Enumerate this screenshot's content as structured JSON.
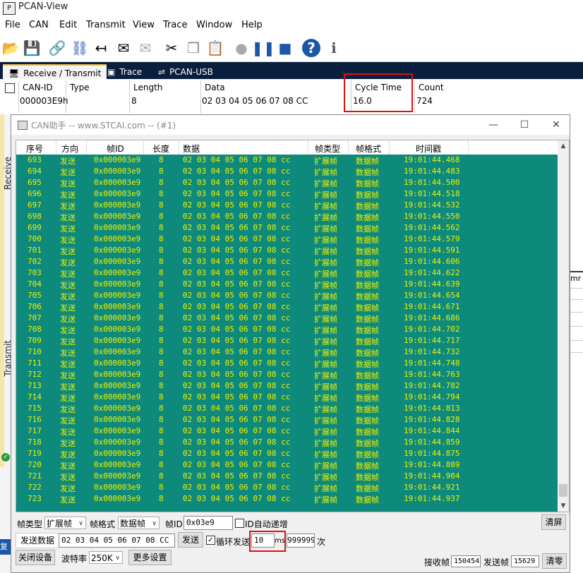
{
  "pcan": {
    "title": "PCAN-View",
    "menu": [
      "File",
      "CAN",
      "Edit",
      "Transmit",
      "View",
      "Trace",
      "Window",
      "Help"
    ],
    "tabs": [
      "Receive / Transmit",
      "Trace",
      "PCAN-USB"
    ],
    "receive_headers": [
      "CAN-ID",
      "Type",
      "Length",
      "Data",
      "Cycle Time",
      "Count"
    ],
    "receive_row": {
      "can_id": "000003E9h",
      "type": "",
      "length": "8",
      "data": "02 03 04 05 06 07 08 CC",
      "cycle_time": "16.0",
      "count": "724"
    },
    "side_labels": {
      "receive": "Receive",
      "transmit": "Transmit"
    },
    "right_partial": "mr",
    "left_partial": "复"
  },
  "canwin": {
    "title": "CAN助手 -- www.STCAI.com -- (#1)",
    "columns": [
      "序号",
      "方向",
      "帧ID",
      "长度",
      "数据",
      "帧类型",
      "帧格式",
      "时间戳"
    ],
    "rows": [
      {
        "seq": "693",
        "dir": "发送",
        "id": "0x000003e9",
        "len": "8",
        "data": "02 03 04 05 06 07 08 cc",
        "ftype": "扩展帧",
        "fmt": "数据帧",
        "ts": "19:01:44.468"
      },
      {
        "seq": "694",
        "dir": "发送",
        "id": "0x000003e9",
        "len": "8",
        "data": "02 03 04 05 06 07 08 cc",
        "ftype": "扩展帧",
        "fmt": "数据帧",
        "ts": "19:01:44.483"
      },
      {
        "seq": "695",
        "dir": "发送",
        "id": "0x000003e9",
        "len": "8",
        "data": "02 03 04 05 06 07 08 cc",
        "ftype": "扩展帧",
        "fmt": "数据帧",
        "ts": "19:01:44.500"
      },
      {
        "seq": "696",
        "dir": "发送",
        "id": "0x000003e9",
        "len": "8",
        "data": "02 03 04 05 06 07 08 cc",
        "ftype": "扩展帧",
        "fmt": "数据帧",
        "ts": "19:01:44.518"
      },
      {
        "seq": "697",
        "dir": "发送",
        "id": "0x000003e9",
        "len": "8",
        "data": "02 03 04 05 06 07 08 cc",
        "ftype": "扩展帧",
        "fmt": "数据帧",
        "ts": "19:01:44.532"
      },
      {
        "seq": "698",
        "dir": "发送",
        "id": "0x000003e9",
        "len": "8",
        "data": "02 03 04 05 06 07 08 cc",
        "ftype": "扩展帧",
        "fmt": "数据帧",
        "ts": "19:01:44.550"
      },
      {
        "seq": "699",
        "dir": "发送",
        "id": "0x000003e9",
        "len": "8",
        "data": "02 03 04 05 06 07 08 cc",
        "ftype": "扩展帧",
        "fmt": "数据帧",
        "ts": "19:01:44.562"
      },
      {
        "seq": "700",
        "dir": "发送",
        "id": "0x000003e9",
        "len": "8",
        "data": "02 03 04 05 06 07 08 cc",
        "ftype": "扩展帧",
        "fmt": "数据帧",
        "ts": "19:01:44.579"
      },
      {
        "seq": "701",
        "dir": "发送",
        "id": "0x000003e9",
        "len": "8",
        "data": "02 03 04 05 06 07 08 cc",
        "ftype": "扩展帧",
        "fmt": "数据帧",
        "ts": "19:01:44.591"
      },
      {
        "seq": "702",
        "dir": "发送",
        "id": "0x000003e9",
        "len": "8",
        "data": "02 03 04 05 06 07 08 cc",
        "ftype": "扩展帧",
        "fmt": "数据帧",
        "ts": "19:01:44.606"
      },
      {
        "seq": "703",
        "dir": "发送",
        "id": "0x000003e9",
        "len": "8",
        "data": "02 03 04 05 06 07 08 cc",
        "ftype": "扩展帧",
        "fmt": "数据帧",
        "ts": "19:01:44.622"
      },
      {
        "seq": "704",
        "dir": "发送",
        "id": "0x000003e9",
        "len": "8",
        "data": "02 03 04 05 06 07 08 cc",
        "ftype": "扩展帧",
        "fmt": "数据帧",
        "ts": "19:01:44.639"
      },
      {
        "seq": "705",
        "dir": "发送",
        "id": "0x000003e9",
        "len": "8",
        "data": "02 03 04 05 06 07 08 cc",
        "ftype": "扩展帧",
        "fmt": "数据帧",
        "ts": "19:01:44.654"
      },
      {
        "seq": "706",
        "dir": "发送",
        "id": "0x000003e9",
        "len": "8",
        "data": "02 03 04 05 06 07 08 cc",
        "ftype": "扩展帧",
        "fmt": "数据帧",
        "ts": "19:01:44.671"
      },
      {
        "seq": "707",
        "dir": "发送",
        "id": "0x000003e9",
        "len": "8",
        "data": "02 03 04 05 06 07 08 cc",
        "ftype": "扩展帧",
        "fmt": "数据帧",
        "ts": "19:01:44.686"
      },
      {
        "seq": "708",
        "dir": "发送",
        "id": "0x000003e9",
        "len": "8",
        "data": "02 03 04 05 06 07 08 cc",
        "ftype": "扩展帧",
        "fmt": "数据帧",
        "ts": "19:01:44.702"
      },
      {
        "seq": "709",
        "dir": "发送",
        "id": "0x000003e9",
        "len": "8",
        "data": "02 03 04 05 06 07 08 cc",
        "ftype": "扩展帧",
        "fmt": "数据帧",
        "ts": "19:01:44.717"
      },
      {
        "seq": "710",
        "dir": "发送",
        "id": "0x000003e9",
        "len": "8",
        "data": "02 03 04 05 06 07 08 cc",
        "ftype": "扩展帧",
        "fmt": "数据帧",
        "ts": "19:01:44.732"
      },
      {
        "seq": "711",
        "dir": "发送",
        "id": "0x000003e9",
        "len": "8",
        "data": "02 03 04 05 06 07 08 cc",
        "ftype": "扩展帧",
        "fmt": "数据帧",
        "ts": "19:01:44.748"
      },
      {
        "seq": "712",
        "dir": "发送",
        "id": "0x000003e9",
        "len": "8",
        "data": "02 03 04 05 06 07 08 cc",
        "ftype": "扩展帧",
        "fmt": "数据帧",
        "ts": "19:01:44.763"
      },
      {
        "seq": "713",
        "dir": "发送",
        "id": "0x000003e9",
        "len": "8",
        "data": "02 03 04 05 06 07 08 cc",
        "ftype": "扩展帧",
        "fmt": "数据帧",
        "ts": "19:01:44.782"
      },
      {
        "seq": "714",
        "dir": "发送",
        "id": "0x000003e9",
        "len": "8",
        "data": "02 03 04 05 06 07 08 cc",
        "ftype": "扩展帧",
        "fmt": "数据帧",
        "ts": "19:01:44.794"
      },
      {
        "seq": "715",
        "dir": "发送",
        "id": "0x000003e9",
        "len": "8",
        "data": "02 03 04 05 06 07 08 cc",
        "ftype": "扩展帧",
        "fmt": "数据帧",
        "ts": "19:01:44.813"
      },
      {
        "seq": "716",
        "dir": "发送",
        "id": "0x000003e9",
        "len": "8",
        "data": "02 03 04 05 06 07 08 cc",
        "ftype": "扩展帧",
        "fmt": "数据帧",
        "ts": "19:01:44.828"
      },
      {
        "seq": "717",
        "dir": "发送",
        "id": "0x000003e9",
        "len": "8",
        "data": "02 03 04 05 06 07 08 cc",
        "ftype": "扩展帧",
        "fmt": "数据帧",
        "ts": "19:01:44.844"
      },
      {
        "seq": "718",
        "dir": "发送",
        "id": "0x000003e9",
        "len": "8",
        "data": "02 03 04 05 06 07 08 cc",
        "ftype": "扩展帧",
        "fmt": "数据帧",
        "ts": "19:01:44.859"
      },
      {
        "seq": "719",
        "dir": "发送",
        "id": "0x000003e9",
        "len": "8",
        "data": "02 03 04 05 06 07 08 cc",
        "ftype": "扩展帧",
        "fmt": "数据帧",
        "ts": "19:01:44.875"
      },
      {
        "seq": "720",
        "dir": "发送",
        "id": "0x000003e9",
        "len": "8",
        "data": "02 03 04 05 06 07 08 cc",
        "ftype": "扩展帧",
        "fmt": "数据帧",
        "ts": "19:01:44.889"
      },
      {
        "seq": "721",
        "dir": "发送",
        "id": "0x000003e9",
        "len": "8",
        "data": "02 03 04 05 06 07 08 cc",
        "ftype": "扩展帧",
        "fmt": "数据帧",
        "ts": "19:01:44.904"
      },
      {
        "seq": "722",
        "dir": "发送",
        "id": "0x000003e9",
        "len": "8",
        "data": "02 03 04 05 06 07 08 cc",
        "ftype": "扩展帧",
        "fmt": "数据帧",
        "ts": "19:01:44.921"
      },
      {
        "seq": "723",
        "dir": "发送",
        "id": "0x000003e9",
        "len": "8",
        "data": "02 03 04 05 06 07 08 cc",
        "ftype": "扩展帧",
        "fmt": "数据帧",
        "ts": "19:01:44.937"
      }
    ],
    "controls": {
      "frame_type_label": "帧类型",
      "frame_type_value": "扩展帧",
      "frame_format_label": "帧格式",
      "frame_format_value": "数据帧",
      "frame_id_label": "帧ID",
      "frame_id_value": "0x03e9",
      "id_auto_inc_label": "ID自动递增",
      "clear_label": "清屏",
      "send_data_label": "发送数据",
      "send_data_value": "02 03 04 05 06 07 08 CC",
      "send_button": "发送",
      "cycle_send_label": "循环发送",
      "cycle_ms_value": "10",
      "cycle_ms_unit": "ms",
      "count_value": "999999",
      "count_unit": "次",
      "close_device": "关闭设备",
      "baud_label": "波特率",
      "baud_value": "250K",
      "more_settings": "更多设置",
      "rx_label": "接收帧",
      "rx_value": "150454",
      "tx_label": "发送帧",
      "tx_value": "15629",
      "clear_counts": "清零"
    }
  },
  "colors": {
    "grid_bg": "#0e8a7c",
    "grid_text": "#f0f000",
    "highlight": "#e01010",
    "tab_bar": "#0a1e3d"
  }
}
